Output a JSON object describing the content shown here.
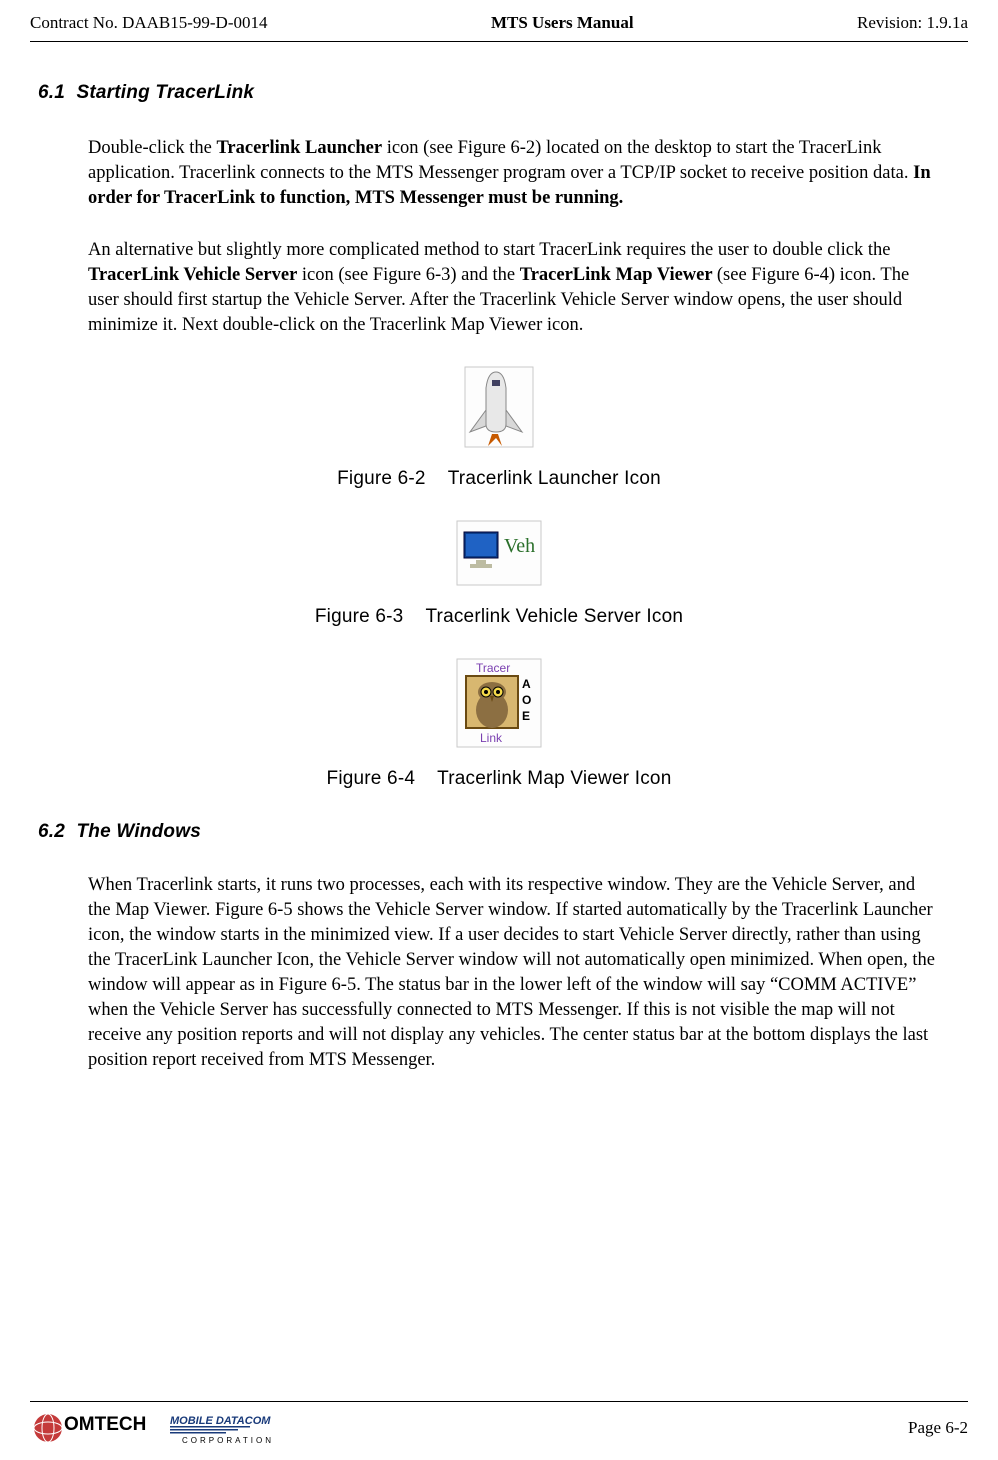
{
  "header": {
    "left": "Contract No. DAAB15-99-D-0014",
    "center": "MTS Users Manual",
    "right": "Revision:  1.9.1a"
  },
  "section61": {
    "number": "6.1",
    "title": "Starting TracerLink"
  },
  "para1": {
    "t1": "Double-click the ",
    "b1": "Tracerlink Launcher",
    "t2": " icon (see Figure 6-2) located on the desktop to start the TracerLink application. Tracerlink connects to the MTS Messenger program over a TCP/IP socket to receive position data.  ",
    "b2": "In order for TracerLink to function, MTS Messenger must be running."
  },
  "para2": {
    "t1": "An alternative but slightly more complicated method to start TracerLink requires the user to double click the ",
    "b1": "TracerLink Vehicle Server",
    "t2": " icon (see Figure 6-3) and the ",
    "b2": "TracerLink Map Viewer ",
    "t3": " (see Figure 6-4) icon.  The user should first startup the Vehicle Server. After the Tracerlink Vehicle Server window opens, the user should minimize it.  Next double-click on the Tracerlink Map Viewer icon."
  },
  "figures": {
    "f62": {
      "num": "Figure 6-2",
      "title": "Tracerlink Launcher Icon"
    },
    "f63": {
      "num": "Figure 6-3",
      "title": "Tracerlink Vehicle Server Icon"
    },
    "f64": {
      "num": "Figure 6-4",
      "title": "Tracerlink Map Viewer Icon"
    }
  },
  "section62": {
    "number": "6.2",
    "title": "The Windows"
  },
  "para3": "When Tracerlink starts, it runs two processes, each with its respective window. They are the Vehicle Server, and the Map Viewer.  Figure 6-5 shows the Vehicle Server window.  If started automatically by the Tracerlink Launcher icon, the window starts in the minimized view.  If a user decides to start Vehicle Server directly, rather than using the TracerLink Launcher Icon, the Vehicle Server window will not automatically open minimized.  When open, the window will appear as in Figure 6-5.  The status bar in the lower left of the window will say “COMM ACTIVE” when the Vehicle Server has successfully connected to MTS Messenger.  If this is not visible the map will not receive any position reports and will not display any vehicles.  The center status bar at the bottom displays the last position report received from MTS Messenger.",
  "footer": {
    "page": "Page 6-2",
    "logo_main": "OMTECH",
    "logo_sub1": "MOBILE DATACOM",
    "logo_sub2": "CORPORATION"
  }
}
